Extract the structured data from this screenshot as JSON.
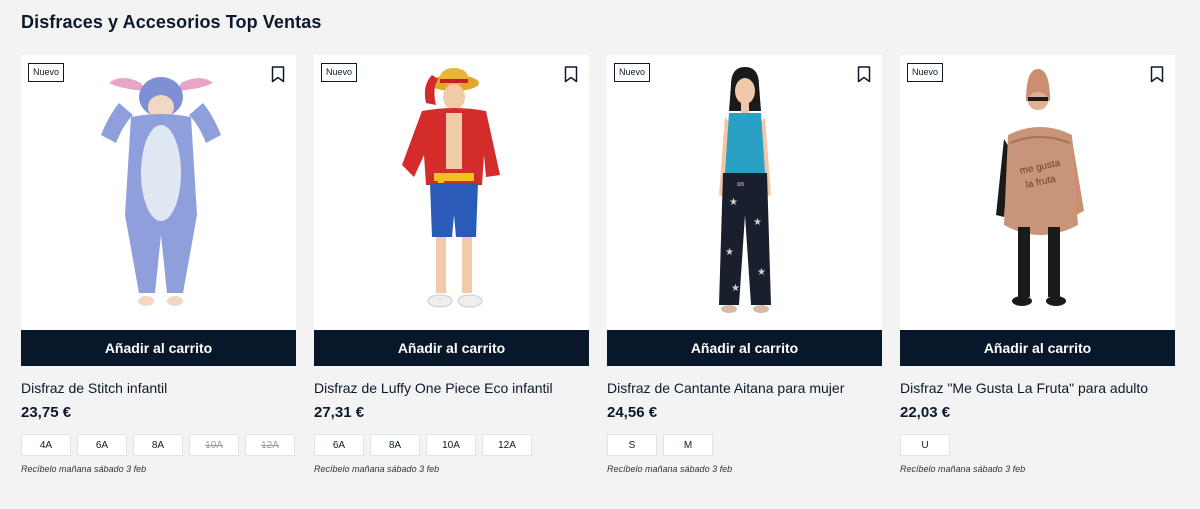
{
  "section": {
    "title": "Disfraces y Accesorios Top Ventas"
  },
  "products": [
    {
      "badge": "Nuevo",
      "icon": "bookmark-icon",
      "image": "stitch-costume-child",
      "cart_label": "Añadir al carrito",
      "name": "Disfraz de Stitch infantil",
      "price": "23,75 €",
      "sizes": [
        {
          "label": "4A",
          "available": true
        },
        {
          "label": "6A",
          "available": true
        },
        {
          "label": "8A",
          "available": true
        },
        {
          "label": "10A",
          "available": false
        },
        {
          "label": "12A",
          "available": false
        }
      ],
      "delivery": "Recíbelo mañana sábado 3 feb"
    },
    {
      "badge": "Nuevo",
      "icon": "bookmark-icon",
      "image": "luffy-costume-child",
      "cart_label": "Añadir al carrito",
      "name": "Disfraz de Luffy One Piece Eco infantil",
      "price": "27,31 €",
      "sizes": [
        {
          "label": "6A",
          "available": true
        },
        {
          "label": "8A",
          "available": true
        },
        {
          "label": "10A",
          "available": true
        },
        {
          "label": "12A",
          "available": true
        }
      ],
      "delivery": "Recíbelo mañana sábado 3 feb"
    },
    {
      "badge": "Nuevo",
      "icon": "bookmark-icon",
      "image": "aitana-singer-costume-woman",
      "cart_label": "Añadir al carrito",
      "name": "Disfraz de Cantante Aitana para mujer",
      "price": "24,56 €",
      "sizes": [
        {
          "label": "S",
          "available": true
        },
        {
          "label": "M",
          "available": true
        }
      ],
      "delivery": "Recíbelo mañana sábado 3 feb"
    },
    {
      "badge": "Nuevo",
      "icon": "bookmark-icon",
      "image": "me-gusta-la-fruta-costume-adult",
      "cart_label": "Añadir al carrito",
      "name": "Disfraz \"Me Gusta La Fruta\" para adulto",
      "price": "22,03 €",
      "sizes": [
        {
          "label": "U",
          "available": true
        }
      ],
      "delivery": "Recíbelo mañana sábado 3 feb"
    }
  ],
  "colors": {
    "primary": "#08172a",
    "background": "#f3f3f3"
  }
}
